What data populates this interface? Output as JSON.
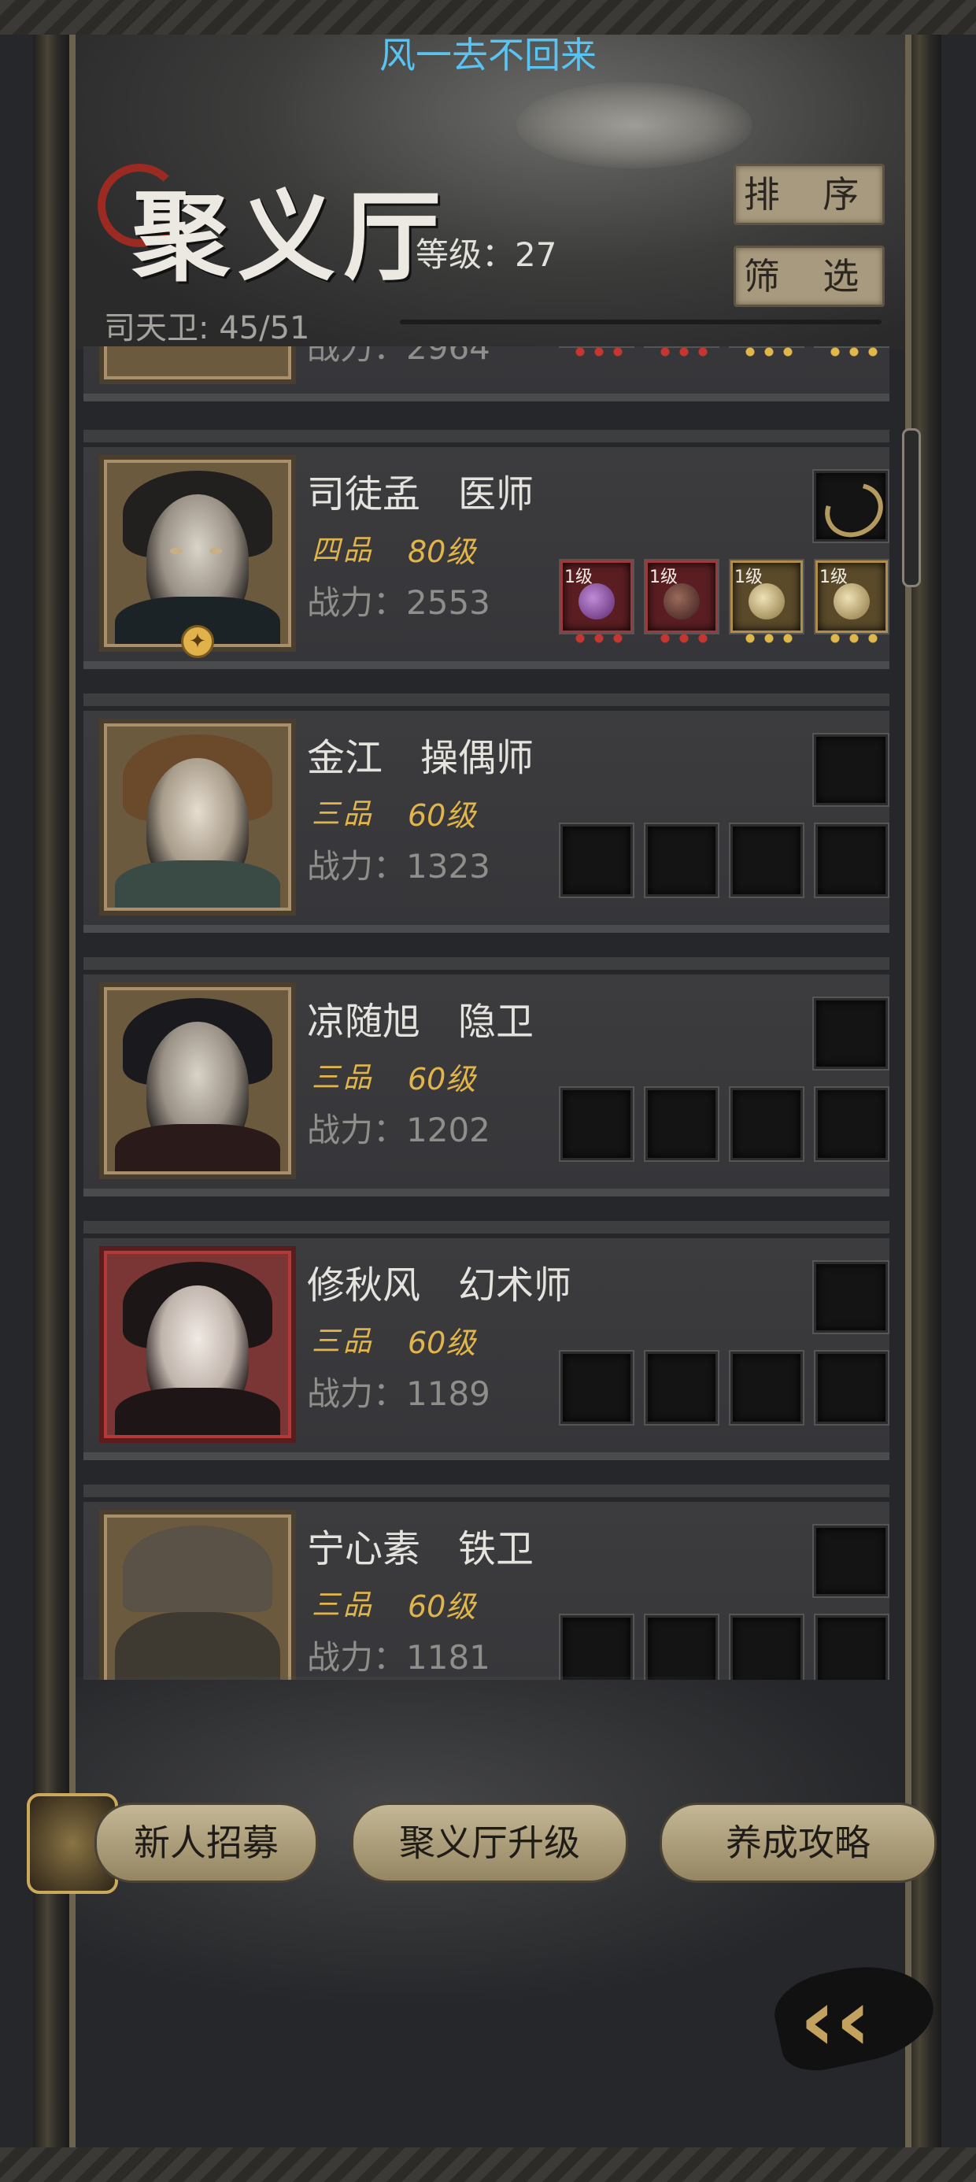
{
  "app": {
    "top_title": "风一去不回来"
  },
  "header": {
    "title": "聚义厅",
    "level_text": "等级：27",
    "guard_text": "司天卫: 45/51",
    "sort_label": "排 序",
    "filter_label": "筛 选"
  },
  "partial_card": {
    "power_text": "战力：2964"
  },
  "characters": [
    {
      "name": "司徒孟　医师",
      "grade": "四品",
      "level": "80级",
      "power": "战力：2553",
      "equipped": true,
      "equip_levels": [
        "1级",
        "1级",
        "1级",
        "1级"
      ],
      "frame": "gold"
    },
    {
      "name": "金江　操偶师",
      "grade": "三品",
      "level": "60级",
      "power": "战力：1323",
      "equipped": false,
      "frame": "gold"
    },
    {
      "name": "凉随旭　隐卫",
      "grade": "三品",
      "level": "60级",
      "power": "战力：1202",
      "equipped": false,
      "frame": "gold"
    },
    {
      "name": "修秋风　幻术师",
      "grade": "三品",
      "level": "60级",
      "power": "战力：1189",
      "equipped": false,
      "frame": "red"
    },
    {
      "name": "宁心素　铁卫",
      "grade": "三品",
      "level": "60级",
      "power": "战力：1181",
      "equipped": false,
      "frame": "gold"
    }
  ],
  "actions": {
    "recruit": "新人招募",
    "upgrade": "聚义厅升级",
    "guide": "养成攻略"
  },
  "icons": {
    "back": "double-chevron-left-icon",
    "recruit": "recruit-token-icon"
  },
  "colors": {
    "accent_gold": "#e2b54a",
    "title_blue": "#59c3f2",
    "button": "#a89a7e"
  }
}
